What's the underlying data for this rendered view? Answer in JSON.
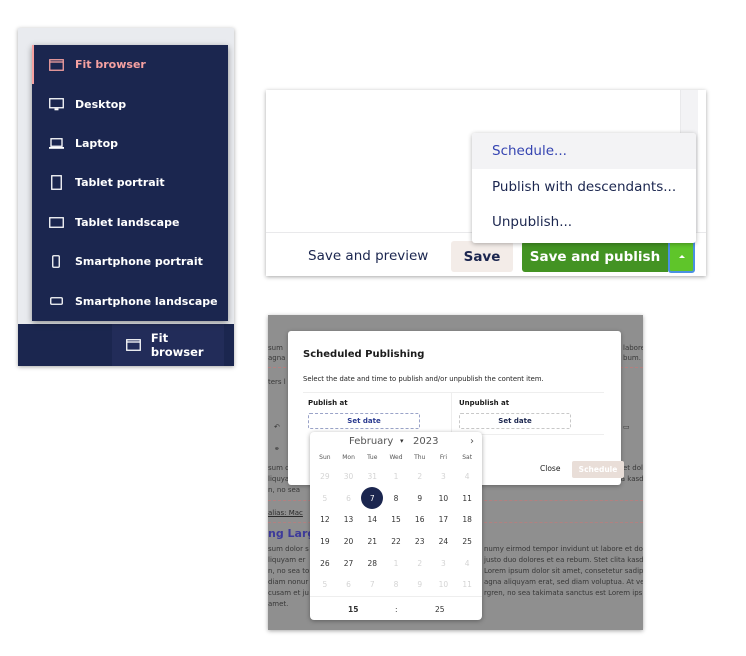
{
  "device_menu": {
    "items": [
      {
        "label": "Fit browser",
        "icon": "browser-window-icon",
        "active": true
      },
      {
        "label": "Desktop",
        "icon": "desktop-monitor-icon",
        "active": false
      },
      {
        "label": "Laptop",
        "icon": "laptop-icon",
        "active": false
      },
      {
        "label": "Tablet portrait",
        "icon": "tablet-portrait-icon",
        "active": false
      },
      {
        "label": "Tablet landscape",
        "icon": "tablet-landscape-icon",
        "active": false
      },
      {
        "label": "Smartphone portrait",
        "icon": "smartphone-portrait-icon",
        "active": false
      },
      {
        "label": "Smartphone landscape",
        "icon": "smartphone-landscape-icon",
        "active": false
      }
    ],
    "current_button": {
      "label": "Fit browser",
      "icon": "browser-window-icon"
    },
    "colors": {
      "background": "#1b264f",
      "active": "#f5a1a1"
    }
  },
  "publish_panel": {
    "dropdown": [
      {
        "label": "Schedule...",
        "highlighted": true
      },
      {
        "label": "Publish with descendants...",
        "highlighted": false
      },
      {
        "label": "Unpublish...",
        "highlighted": false
      }
    ],
    "buttons": {
      "preview": "Save and preview",
      "save": "Save",
      "save_and_publish": "Save and publish",
      "more_options_icon": "caret-up-icon"
    },
    "colors": {
      "primary_green": "#439323",
      "caret_green": "#5fc52a",
      "save_bg": "#f3ece8"
    }
  },
  "schedule_dialog": {
    "title": "Scheduled Publishing",
    "description": "Select the date and time to publish and/or unpublish the content item.",
    "publish_at": {
      "label": "Publish at",
      "button": "Set date"
    },
    "unpublish_at": {
      "label": "Unpublish at",
      "button": "Set date"
    },
    "close_label": "Close",
    "schedule_label": "Schedule",
    "calendar": {
      "month": "February",
      "year": "2023",
      "weekdays": [
        "Sun",
        "Mon",
        "Tue",
        "Wed",
        "Thu",
        "Fri",
        "Sat"
      ],
      "days": [
        {
          "d": "29",
          "m": true
        },
        {
          "d": "30",
          "m": true
        },
        {
          "d": "31",
          "m": true
        },
        {
          "d": "1",
          "m": true
        },
        {
          "d": "2",
          "m": true
        },
        {
          "d": "3",
          "m": true
        },
        {
          "d": "4",
          "m": true
        },
        {
          "d": "5",
          "m": true
        },
        {
          "d": "6",
          "m": true
        },
        {
          "d": "7",
          "s": true
        },
        {
          "d": "8"
        },
        {
          "d": "9"
        },
        {
          "d": "10"
        },
        {
          "d": "11"
        },
        {
          "d": "12"
        },
        {
          "d": "13"
        },
        {
          "d": "14"
        },
        {
          "d": "15"
        },
        {
          "d": "16"
        },
        {
          "d": "17"
        },
        {
          "d": "18"
        },
        {
          "d": "19"
        },
        {
          "d": "20"
        },
        {
          "d": "21"
        },
        {
          "d": "22"
        },
        {
          "d": "23"
        },
        {
          "d": "24"
        },
        {
          "d": "25"
        },
        {
          "d": "26"
        },
        {
          "d": "27"
        },
        {
          "d": "28"
        },
        {
          "d": "1",
          "m": true
        },
        {
          "d": "2",
          "m": true
        },
        {
          "d": "3",
          "m": true
        },
        {
          "d": "4",
          "m": true
        },
        {
          "d": "5",
          "m": true
        },
        {
          "d": "6",
          "m": true
        },
        {
          "d": "7",
          "m": true
        },
        {
          "d": "8",
          "m": true
        },
        {
          "d": "9",
          "m": true
        },
        {
          "d": "10",
          "m": true
        },
        {
          "d": "11",
          "m": true
        }
      ],
      "selected_day": "7",
      "hour": "15",
      "time_separator": ":",
      "minute": "25"
    },
    "background": {
      "lines_left": [
        "sum",
        "agna",
        "ters l"
      ],
      "lines_right": [
        "labore",
        "bum."
      ],
      "text_left_1": [
        "sum c",
        "liquyam er",
        "n, no sea"
      ],
      "alias": "alias: Mac",
      "heading": "ng Larg",
      "text_left_2": [
        "sum dolor s",
        "liquyam er",
        "n, no sea to",
        "diam nonur",
        "cusam et ju",
        "amet."
      ],
      "text_right_1": [
        "et dol",
        "justo duo dolores et ea rebum. Stet clita kasd"
      ],
      "text_right_2": [
        "numy eirmod tempor invidunt ut labore et dol",
        "justo duo dolores et ea rebum. Stet clita kasd",
        "Lorem ipsum dolor sit amet, consetetur sadip",
        "agna aliquyam erat, sed diam voluptua. At ve",
        "rgren, no sea takimata sanctus est Lorem ips"
      ]
    }
  }
}
